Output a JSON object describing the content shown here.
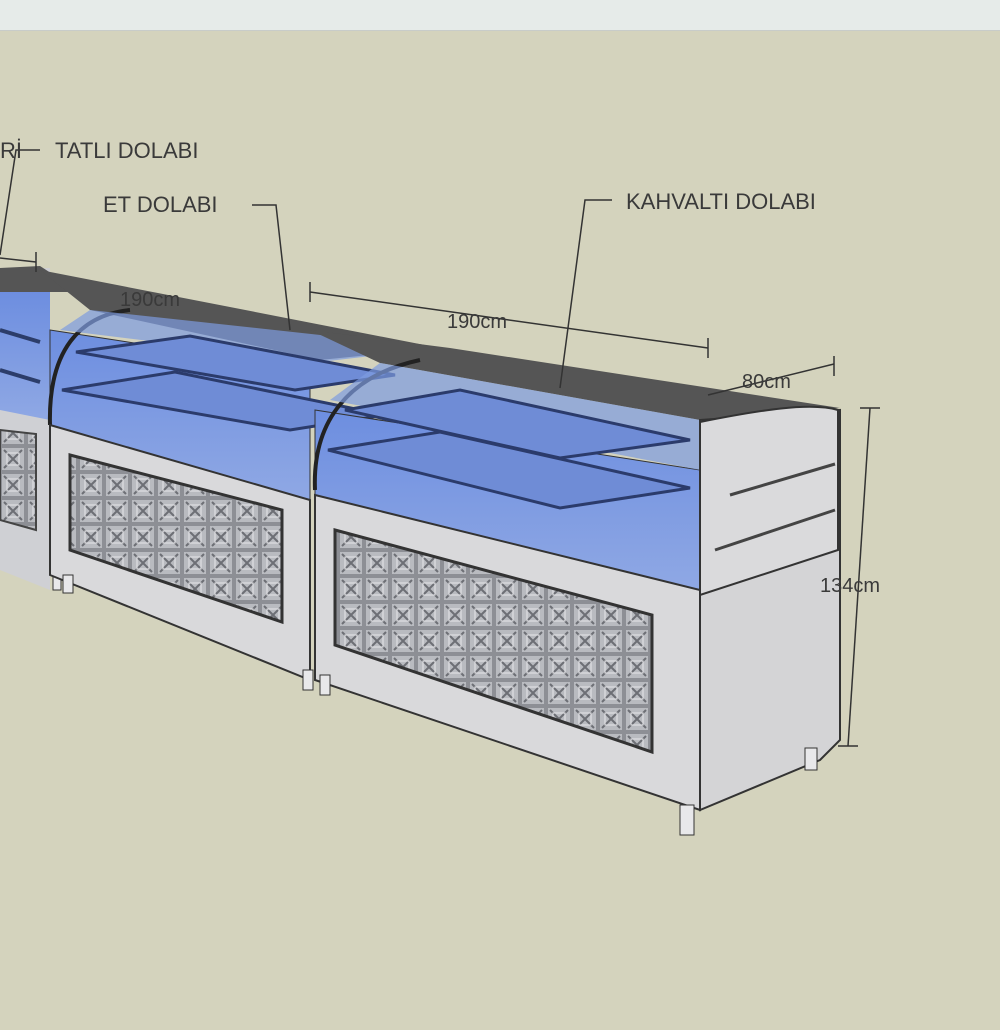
{
  "labels": {
    "partial_left": "Rİ",
    "tatli": "TATLI DOLABI",
    "et": "ET DOLABI",
    "kahvalti": "KAHVALTI DOLABI"
  },
  "dimensions": {
    "hidden_width": "190cm",
    "width": "190cm",
    "depth": "80cm",
    "height": "134cm"
  },
  "colors": {
    "background": "#d4d3bd",
    "glass": "#6f8fd8",
    "steel": "#d9d9db",
    "top": "#555555"
  }
}
